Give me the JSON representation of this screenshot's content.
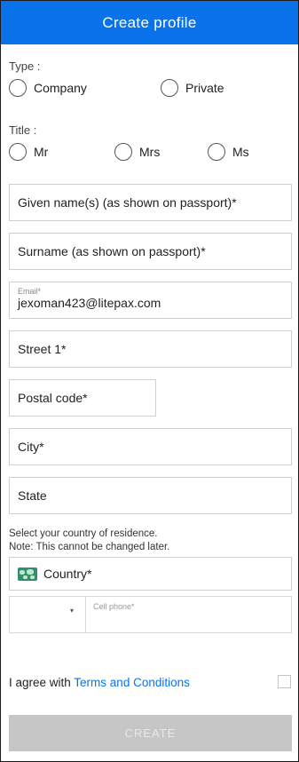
{
  "header": {
    "title": "Create profile"
  },
  "type": {
    "label": "Type :",
    "options": [
      "Company",
      "Private"
    ]
  },
  "title_group": {
    "label": "Title :",
    "options": [
      "Mr",
      "Mrs",
      "Ms"
    ]
  },
  "fields": {
    "given_name": "Given name(s) (as shown on passport)*",
    "surname": "Surname (as shown on passport)*",
    "email_label": "Email*",
    "email_value": "jexoman423@litepax.com",
    "street1": "Street 1*",
    "postal_code": "Postal code*",
    "city": "City*",
    "state": "State"
  },
  "country": {
    "note_line1": "Select your country of residence.",
    "note_line2": "Note: This cannot be changed later.",
    "placeholder": "Country*",
    "icon": "world-map-icon"
  },
  "phone": {
    "label": "Cell phone*",
    "caret": "▾"
  },
  "terms": {
    "prefix": "I agree with ",
    "link": "Terms and Conditions"
  },
  "create_button": "CREATE",
  "colors": {
    "accent": "#0a73eb",
    "button_disabled": "#c6c6c6",
    "border": "#cfcfcf"
  }
}
